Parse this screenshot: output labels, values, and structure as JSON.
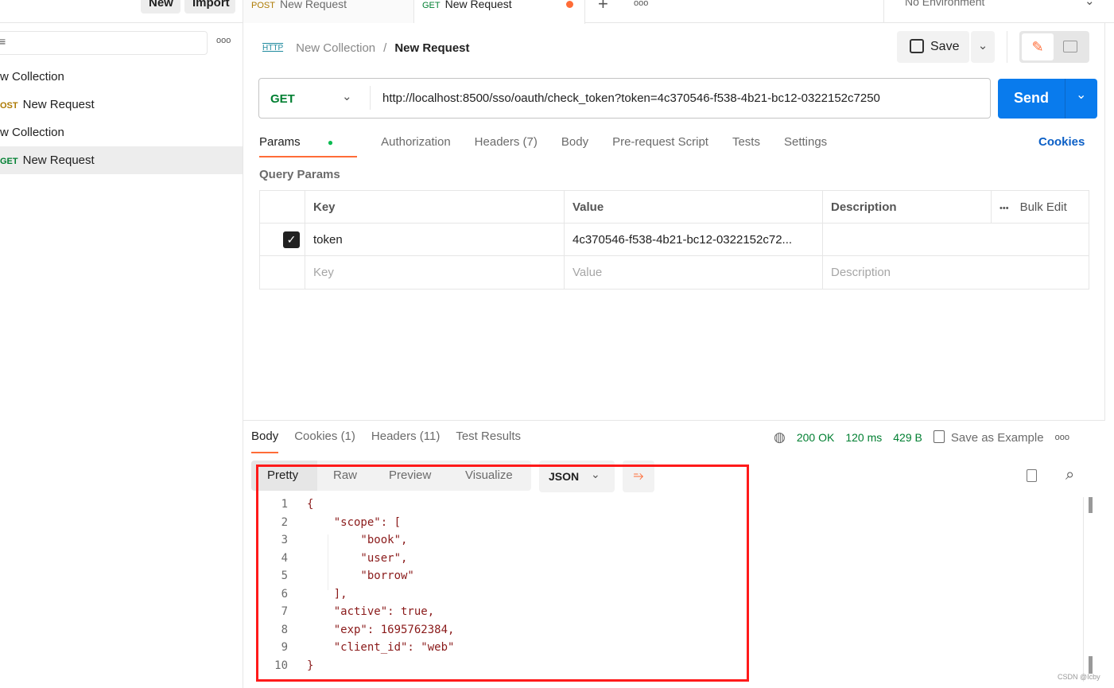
{
  "sidebar": {
    "new_label": "New",
    "import_label": "Import",
    "more": "ooo",
    "items": [
      {
        "label": "w Collection",
        "method": ""
      },
      {
        "label": "New Request",
        "method": "OST"
      },
      {
        "label": "w Collection",
        "method": ""
      },
      {
        "label": "New Request",
        "method": "GET",
        "selected": true
      }
    ]
  },
  "tabs": [
    {
      "method": "POST",
      "label": "New Request"
    },
    {
      "method": "GET",
      "label": "New Request",
      "unsaved": true
    }
  ],
  "tabbar": {
    "add": "+",
    "more": "ooo",
    "environment": "No Environment"
  },
  "breadcrumb": {
    "icon": "HTTP",
    "collection": "New Collection",
    "sep": "/",
    "request": "New Request"
  },
  "toolbar": {
    "save_label": "Save"
  },
  "request": {
    "method": "GET",
    "url": "http://localhost:8500/sso/oauth/check_token?token=4c370546-f538-4b21-bc12-0322152c7250",
    "send_label": "Send"
  },
  "req_tabs": [
    "Params",
    "Authorization",
    "Headers (7)",
    "Body",
    "Pre-request Script",
    "Tests",
    "Settings"
  ],
  "cookies_label": "Cookies",
  "query": {
    "title": "Query Params",
    "headers": {
      "key": "Key",
      "value": "Value",
      "description": "Description",
      "bulk": "Bulk Edit",
      "more": "•••"
    },
    "rows": [
      {
        "checked": true,
        "key": "token",
        "value": "4c370546-f538-4b21-bc12-0322152c72..."
      }
    ],
    "placeholder": {
      "key": "Key",
      "value": "Value",
      "description": "Description"
    }
  },
  "response": {
    "tabs": [
      "Body",
      "Cookies (1)",
      "Headers (11)",
      "Test Results"
    ],
    "status": "200 OK",
    "time": "120 ms",
    "size": "429 B",
    "save_example": "Save as Example",
    "more": "ooo",
    "views": [
      "Pretty",
      "Raw",
      "Preview",
      "Visualize"
    ],
    "format": "JSON",
    "lines": [
      "{",
      "    \"scope\": [",
      "        \"book\",",
      "        \"user\",",
      "        \"borrow\"",
      "    ],",
      "    \"active\": true,",
      "    \"exp\": 1695762384,",
      "    \"client_id\": \"web\"",
      "}"
    ]
  },
  "watermark": "CSDN @Icby",
  "colors": {
    "accent": "#ff6c37",
    "send": "#097bed",
    "highlight_box": "#ff1a1a"
  }
}
